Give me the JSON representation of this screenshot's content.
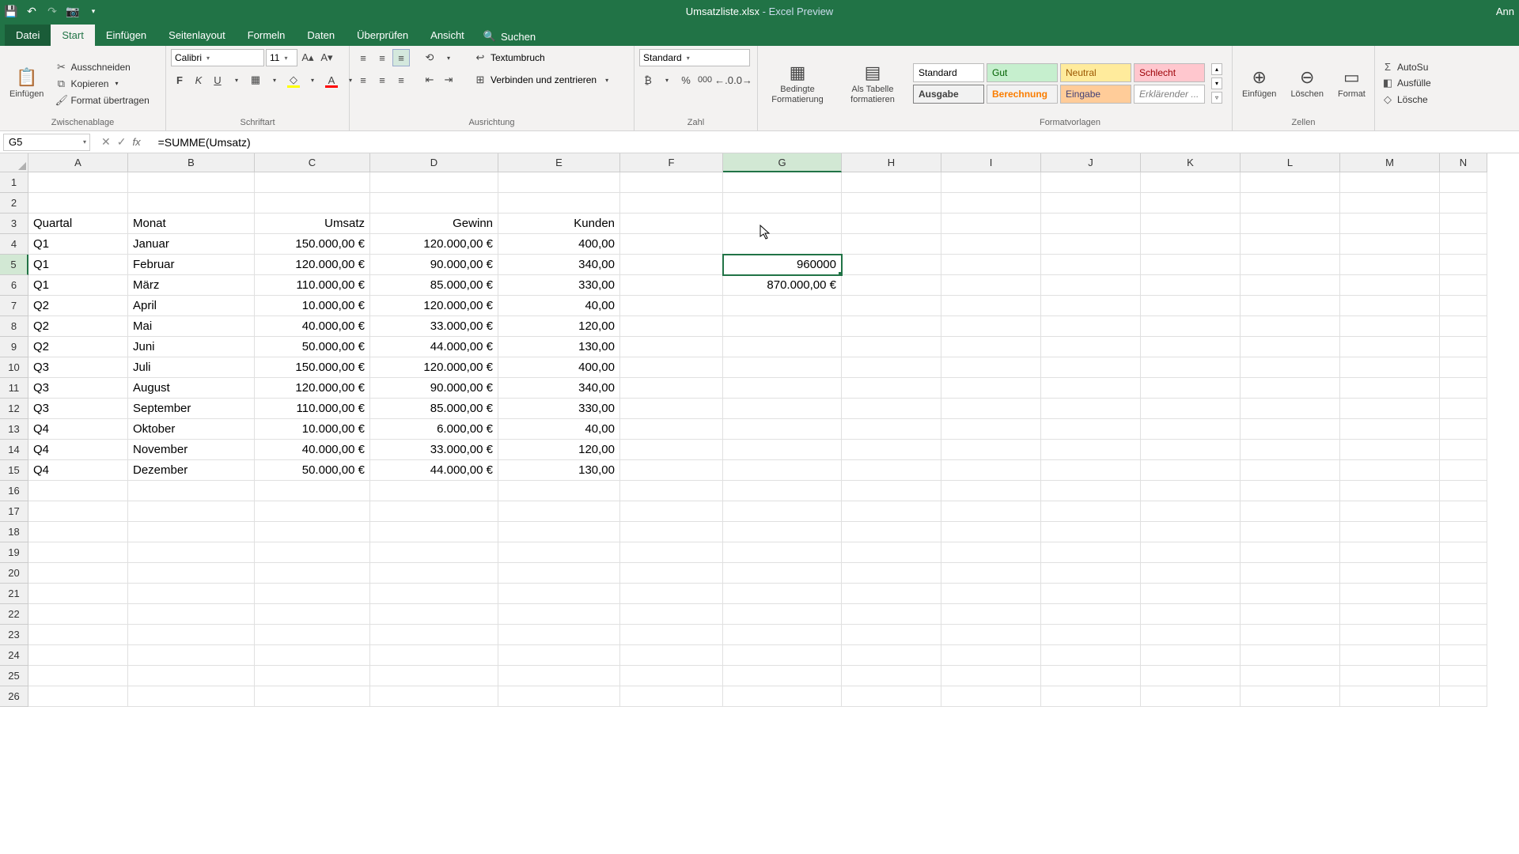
{
  "title": {
    "filename": "Umsatzliste.xlsx",
    "app": "Excel Preview",
    "right": "Ann"
  },
  "tabs": {
    "file": "Datei",
    "home": "Start",
    "insert": "Einfügen",
    "layout": "Seitenlayout",
    "formulas": "Formeln",
    "data": "Daten",
    "review": "Überprüfen",
    "view": "Ansicht",
    "search": "Suchen"
  },
  "clipboard": {
    "paste": "Einfügen",
    "cut": "Ausschneiden",
    "copy": "Kopieren",
    "painter": "Format übertragen",
    "group": "Zwischenablage"
  },
  "font": {
    "name": "Calibri",
    "size": "11",
    "group": "Schriftart"
  },
  "alignment": {
    "wrap": "Textumbruch",
    "merge": "Verbinden und zentrieren",
    "group": "Ausrichtung"
  },
  "number": {
    "format": "Standard",
    "group": "Zahl"
  },
  "cond": {
    "label": "Bedingte Formatierung"
  },
  "astable": {
    "label": "Als Tabelle formatieren"
  },
  "styles": {
    "standard": "Standard",
    "gut": "Gut",
    "neutral": "Neutral",
    "schlecht": "Schlecht",
    "ausgabe": "Ausgabe",
    "berechnung": "Berechnung",
    "eingabe": "Eingabe",
    "erklaerend": "Erklärender ...",
    "group": "Formatvorlagen"
  },
  "cells_group": {
    "insert": "Einfügen",
    "delete": "Löschen",
    "format": "Format",
    "group": "Zellen"
  },
  "editing": {
    "autosum": "AutoSu",
    "fill": "Ausfülle",
    "clear": "Lösche"
  },
  "formula_bar": {
    "cell_ref": "G5",
    "formula": "=SUMME(Umsatz)"
  },
  "columns": [
    "A",
    "B",
    "C",
    "D",
    "E",
    "F",
    "G",
    "H",
    "I",
    "J",
    "K",
    "L",
    "M",
    "N"
  ],
  "col_widths": {
    "A": 126,
    "B": 160,
    "C": 146,
    "D": 162,
    "E": 154,
    "F": 130,
    "G": 150,
    "H": 126,
    "I": 126,
    "J": 126,
    "K": 126,
    "L": 126,
    "M": 126,
    "N": 60
  },
  "active_col": "G",
  "active_row": 5,
  "row_count": 26,
  "headers": {
    "A": "Quartal",
    "B": "Monat",
    "C": "Umsatz",
    "D": "Gewinn",
    "E": "Kunden"
  },
  "data_rows": [
    {
      "A": "Q1",
      "B": "Januar",
      "C": "150.000,00 €",
      "D": "120.000,00 €",
      "E": "400,00"
    },
    {
      "A": "Q1",
      "B": "Februar",
      "C": "120.000,00 €",
      "D": "90.000,00 €",
      "E": "340,00",
      "G": "960000"
    },
    {
      "A": "Q1",
      "B": "März",
      "C": "110.000,00 €",
      "D": "85.000,00 €",
      "E": "330,00",
      "G": "870.000,00 €"
    },
    {
      "A": "Q2",
      "B": "April",
      "C": "10.000,00 €",
      "D": "120.000,00 €",
      "E": "40,00"
    },
    {
      "A": "Q2",
      "B": "Mai",
      "C": "40.000,00 €",
      "D": "33.000,00 €",
      "E": "120,00"
    },
    {
      "A": "Q2",
      "B": "Juni",
      "C": "50.000,00 €",
      "D": "44.000,00 €",
      "E": "130,00"
    },
    {
      "A": "Q3",
      "B": "Juli",
      "C": "150.000,00 €",
      "D": "120.000,00 €",
      "E": "400,00"
    },
    {
      "A": "Q3",
      "B": "August",
      "C": "120.000,00 €",
      "D": "90.000,00 €",
      "E": "340,00"
    },
    {
      "A": "Q3",
      "B": "September",
      "C": "110.000,00 €",
      "D": "85.000,00 €",
      "E": "330,00"
    },
    {
      "A": "Q4",
      "B": "Oktober",
      "C": "10.000,00 €",
      "D": "6.000,00 €",
      "E": "40,00"
    },
    {
      "A": "Q4",
      "B": "November",
      "C": "40.000,00 €",
      "D": "33.000,00 €",
      "E": "120,00"
    },
    {
      "A": "Q4",
      "B": "Dezember",
      "C": "50.000,00 €",
      "D": "44.000,00 €",
      "E": "130,00"
    }
  ],
  "right_align_cols": [
    "C",
    "D",
    "E",
    "G"
  ]
}
